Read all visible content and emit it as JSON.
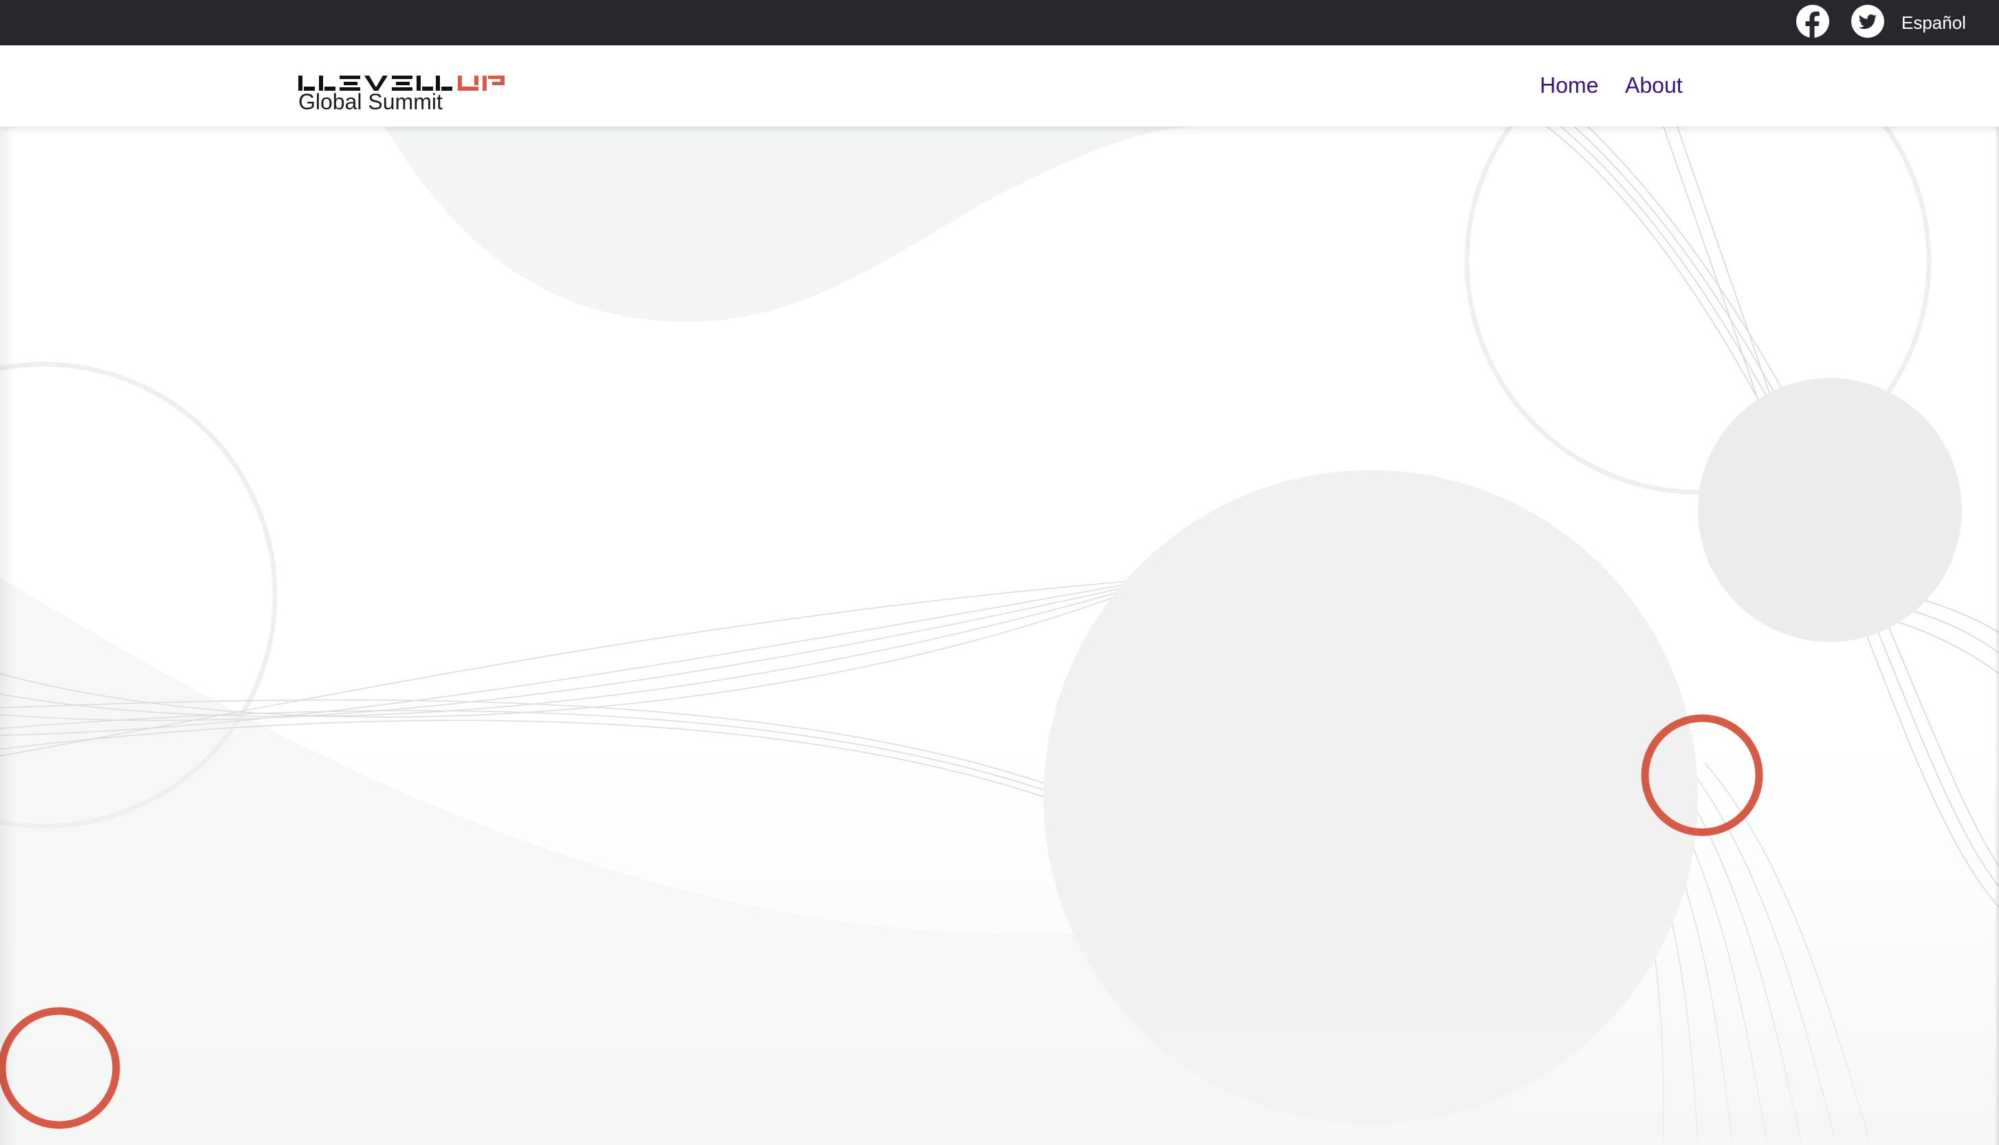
{
  "topbar": {
    "facebook_icon": "facebook-icon",
    "twitter_icon": "twitter-icon",
    "language_label": "Español"
  },
  "header": {
    "logo": {
      "word_dark": "LEVEL",
      "word_accent": "UP",
      "subtitle": "Global Summit"
    },
    "nav": {
      "home_label": "Home",
      "about_label": "About"
    }
  },
  "colors": {
    "topbar_bg": "#27282d",
    "accent": "#d65a45",
    "nav_link": "#3b1083",
    "decor_fill": "#f1f1f1"
  }
}
